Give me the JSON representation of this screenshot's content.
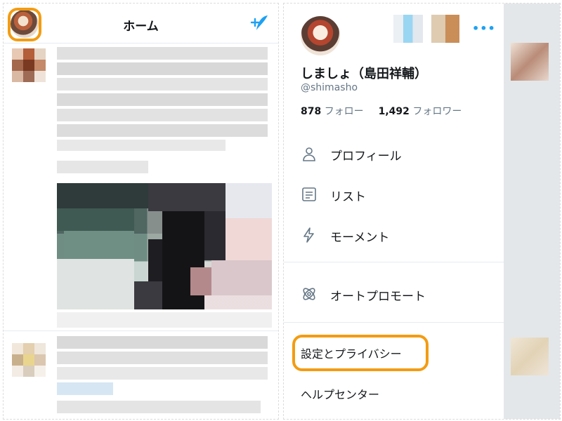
{
  "home": {
    "title": "ホーム"
  },
  "drawer": {
    "name": "しましょ（島田祥輔）",
    "handle": "@shimasho",
    "following_count": "878",
    "following_label": "フォロー",
    "followers_count": "1,492",
    "followers_label": "フォロワー",
    "more_icon": "•••",
    "menu": [
      {
        "label": "プロフィール",
        "icon": "person-icon"
      },
      {
        "label": "リスト",
        "icon": "list-icon"
      },
      {
        "label": "モーメント",
        "icon": "bolt-icon"
      },
      {
        "label": "オートプロモート",
        "icon": "promote-icon"
      }
    ],
    "settings_label": "設定とプライバシー",
    "help_label": "ヘルプセンター"
  },
  "colors": {
    "accent": "#1da1f2",
    "highlight": "#f39c12",
    "muted": "#657786"
  }
}
